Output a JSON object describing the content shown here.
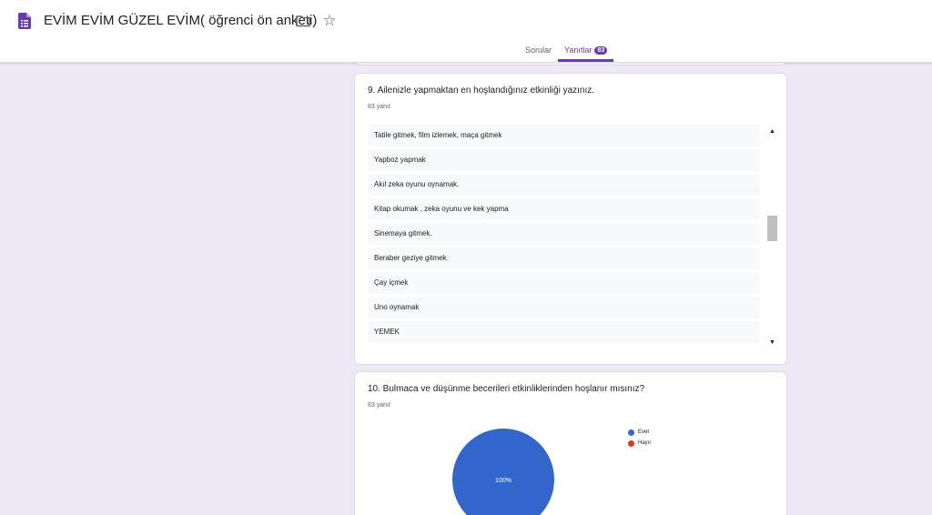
{
  "header": {
    "title": "EVİM EVİM GÜZEL EVİM( öğrenci ön anketi)",
    "icons": {
      "doc": "forms-doc-icon",
      "folder": "folder-icon",
      "star": "star-icon"
    },
    "star_glyph": "☆"
  },
  "tabs": {
    "questions_label": "Sorular",
    "responses_label": "Yanıtlar",
    "responses_count": "83"
  },
  "colors": {
    "accent": "#673ab7",
    "background": "#ede7f6",
    "pie_evet": "#3366cc",
    "pie_hayir": "#dc3912"
  },
  "question9": {
    "title": "9. Ailenizle yapmaktan en hoşlandığınız etkinliği yazınız.",
    "count": "83 yanıt",
    "responses": [
      "Tatile gitmek, film izlemek, maça gitmek",
      "Yapboz yapmak",
      "Akıl zeka oyunu oynamak.",
      "Kitap okumak , zeka oyunu ve kek yapma",
      "Sinemaya gitmek.",
      "Beraber geziye gitmek",
      "Çay içmek",
      "Uno oynamak",
      "YEMEK"
    ],
    "scroll": {
      "up_glyph": "▲",
      "down_glyph": "▼",
      "position_fraction": 0.45
    }
  },
  "question10": {
    "title": "10. Bulmaca ve düşünme becerileri etkinliklerinden hoşlanır mısınız?",
    "count": "83 yanıt"
  },
  "chart_data": {
    "type": "pie",
    "categories": [
      "Evet",
      "Hayır"
    ],
    "values": [
      100,
      0
    ],
    "colors": [
      "#3366cc",
      "#dc3912"
    ],
    "data_labels": [
      "100%"
    ],
    "legend_position": "right"
  }
}
